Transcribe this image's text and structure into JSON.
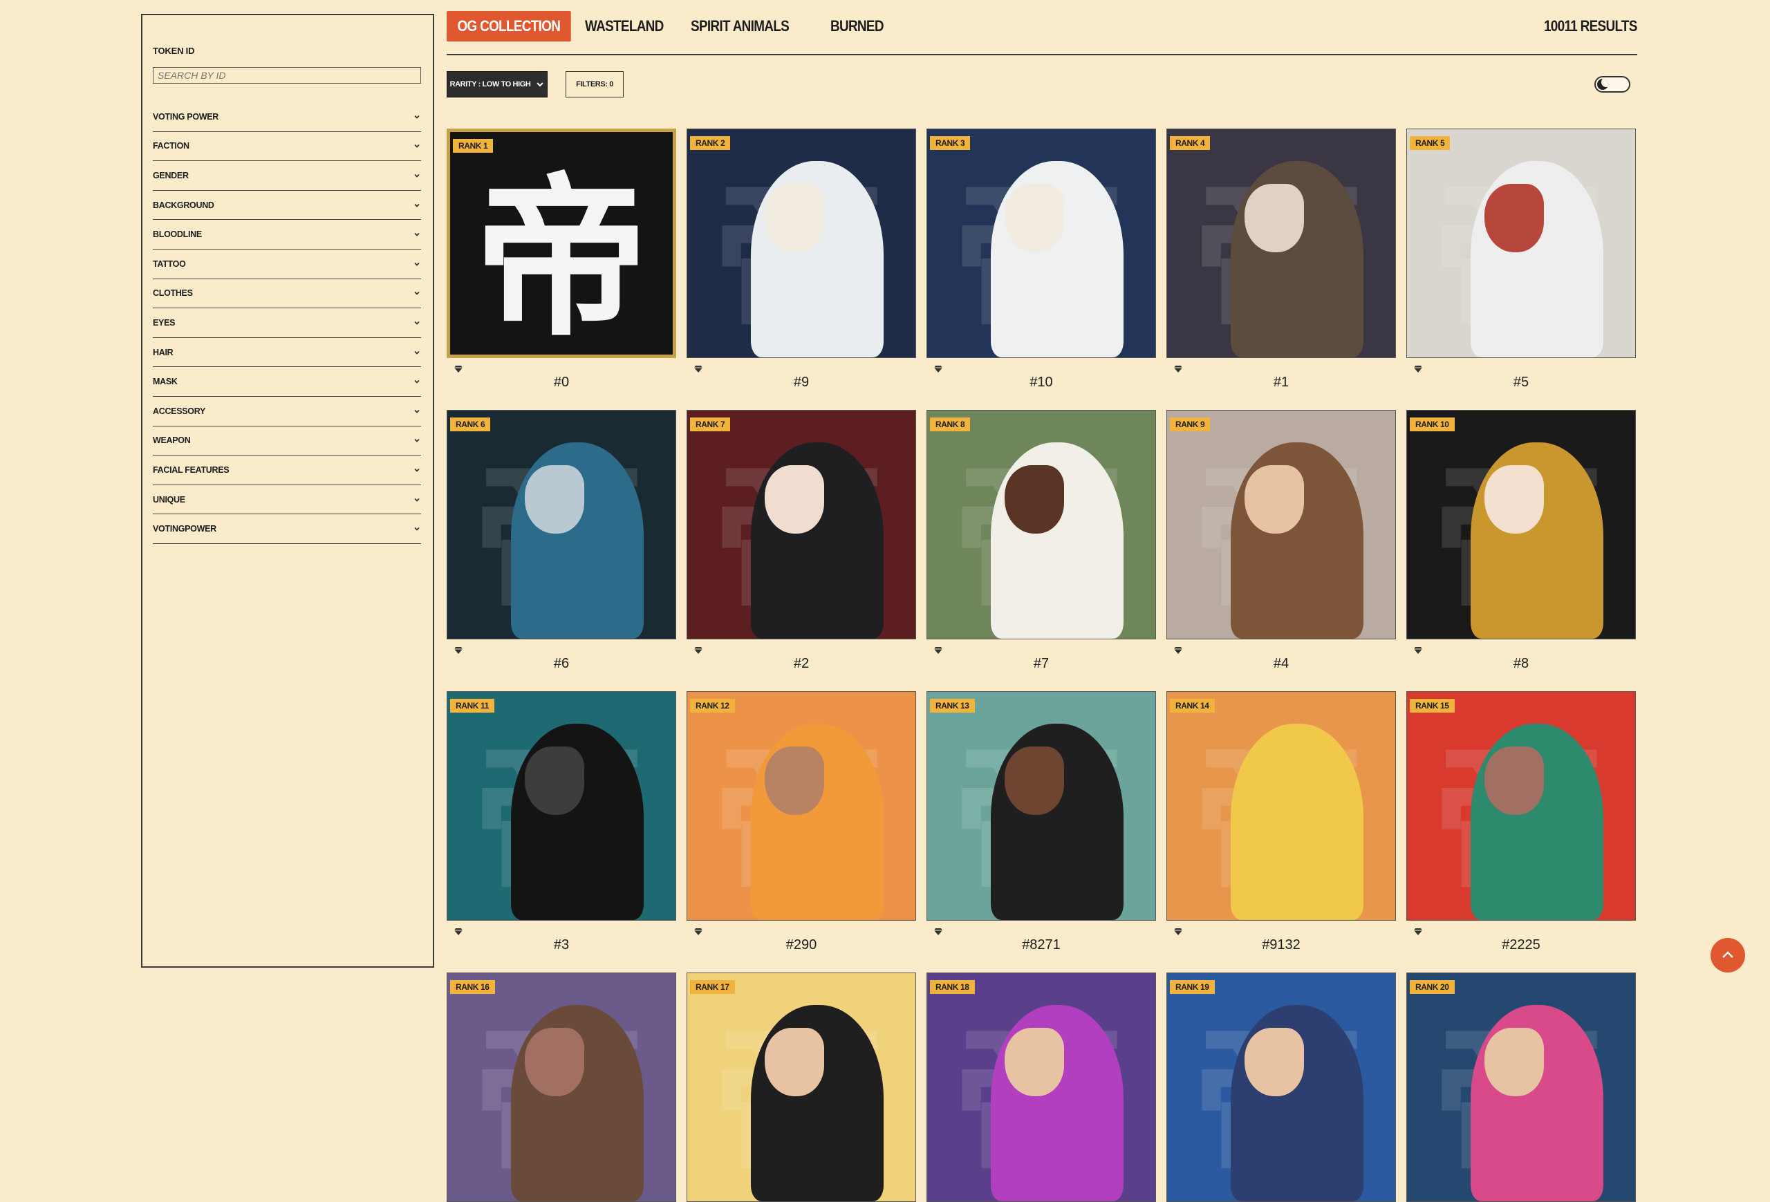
{
  "sidebar": {
    "token_label": "TOKEN ID",
    "search_placeholder": "SEARCH BY ID",
    "filters": [
      "VOTING POWER",
      "FACTION",
      "GENDER",
      "BACKGROUND",
      "BLOODLINE",
      "TATTOO",
      "CLOTHES",
      "EYES",
      "HAIR",
      "MASK",
      "ACCESSORY",
      "WEAPON",
      "FACIAL FEATURES",
      "UNIQUE",
      "VOTINGPOWER"
    ]
  },
  "tabs": [
    "OG COLLECTION",
    "WASTELAND",
    "SPIRIT ANIMALS",
    "BURNED"
  ],
  "active_tab": "OG COLLECTION",
  "results": {
    "count": "10011",
    "label": "RESULTS"
  },
  "toolbar": {
    "sort_label": "RARITY : LOW TO HIGH",
    "filters_label": "FILTERS: 0"
  },
  "colors": {
    "accent": "#e0582f",
    "rank_badge": "#f2b33d",
    "background": "#faebcb"
  },
  "cards": [
    {
      "rank": "RANK 1",
      "token": "#0",
      "bg": "#141414",
      "skin": "#ffffff",
      "hair": "#ffffff",
      "special": true
    },
    {
      "rank": "RANK 2",
      "token": "#9",
      "bg": "#1e2c48",
      "skin": "#f1ebe0",
      "hair": "#e9edf0"
    },
    {
      "rank": "RANK 3",
      "token": "#10",
      "bg": "#223457",
      "skin": "#f1ebe0",
      "hair": "#eef0f2"
    },
    {
      "rank": "RANK 4",
      "token": "#1",
      "bg": "#3b3644",
      "skin": "#dfd2c2",
      "hair": "#5c4c3e"
    },
    {
      "rank": "RANK 5",
      "token": "#5",
      "bg": "#d9d5cf",
      "skin": "#b7463b",
      "hair": "#eeeeee"
    },
    {
      "rank": "RANK 6",
      "token": "#6",
      "bg": "#1a2a32",
      "skin": "#b9c9d2",
      "hair": "#2c6c8a"
    },
    {
      "rank": "RANK 7",
      "token": "#2",
      "bg": "#5c1e21",
      "skin": "#f0ddd0",
      "hair": "#1f1f22"
    },
    {
      "rank": "RANK 8",
      "token": "#7",
      "bg": "#6e8659",
      "skin": "#5a3424",
      "hair": "#f2efe8"
    },
    {
      "rank": "RANK 9",
      "token": "#4",
      "bg": "#b9aaa2",
      "skin": "#e7c3a3",
      "hair": "#7d5538"
    },
    {
      "rank": "RANK 10",
      "token": "#8",
      "bg": "#1a1a1a",
      "skin": "#f3e0cf",
      "hair": "#c9972e"
    },
    {
      "rank": "RANK 11",
      "token": "#3",
      "bg": "#1e6a72",
      "skin": "#3d3d3d",
      "hair": "#141414"
    },
    {
      "rank": "RANK 12",
      "token": "#290",
      "bg": "#ec9349",
      "skin": "#b88362",
      "hair": "#f29a3a"
    },
    {
      "rank": "RANK 13",
      "token": "#8271",
      "bg": "#6aa49a",
      "skin": "#6e4530",
      "hair": "#1f1f1f"
    },
    {
      "rank": "RANK 14",
      "token": "#9132",
      "bg": "#e8964c",
      "skin": "#f1c94a",
      "hair": "#f1c94a"
    },
    {
      "rank": "RANK 15",
      "token": "#2225",
      "bg": "#d83a2e",
      "skin": "#a17062",
      "hair": "#2e8a6d"
    },
    {
      "rank": "RANK 16",
      "token": "",
      "bg": "#6a5b8a",
      "skin": "#a17062",
      "hair": "#6a4b3a"
    },
    {
      "rank": "RANK 17",
      "token": "",
      "bg": "#f0d27a",
      "skin": "#e7c3a3",
      "hair": "#1f1f1f"
    },
    {
      "rank": "RANK 18",
      "token": "",
      "bg": "#5a3f8a",
      "skin": "#e7c3a3",
      "hair": "#b13fbf"
    },
    {
      "rank": "RANK 19",
      "token": "",
      "bg": "#2c5aa0",
      "skin": "#e7c3a3",
      "hair": "#2c3f70"
    },
    {
      "rank": "RANK 20",
      "token": "",
      "bg": "#244870",
      "skin": "#e7c3a3",
      "hair": "#d84a8a"
    }
  ],
  "special_glyph": "帝"
}
